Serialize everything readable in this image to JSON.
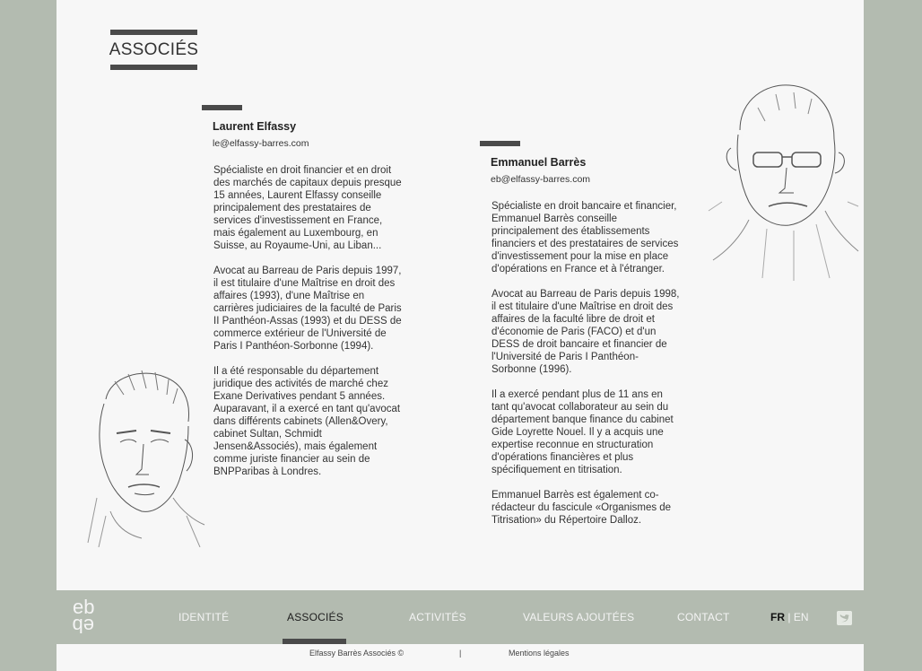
{
  "section_title": "ASSOCIÉS",
  "partners": [
    {
      "name": "Laurent Elfassy",
      "email": "le@elfassy-barres.com",
      "paragraphs": [
        "Spécialiste en droit financier et en droit des marchés de capitaux depuis presque 15 années, Laurent Elfassy conseille principalement des prestataires de services d'investissement en France, mais également au Luxembourg, en Suisse, au Royaume-Uni, au Liban...",
        "Avocat au Barreau de Paris depuis 1997, il est titulaire d'une Maîtrise en droit des affaires (1993), d'une Maîtrise en carrières judiciaires de la faculté de Paris II Panthéon-Assas (1993) et du DESS de commerce extérieur de l'Université de Paris I Panthéon-Sorbonne (1994).",
        "Il a été responsable du département juridique des activités de marché chez Exane Derivatives pendant 5 années. Auparavant, il a exercé en tant qu'avocat dans différents cabinets (Allen&Overy, cabinet Sultan, Schmidt Jensen&Associés), mais également comme juriste financier au sein de BNPParibas à Londres."
      ]
    },
    {
      "name": "Emmanuel Barrès",
      "email": "eb@elfassy-barres.com",
      "paragraphs": [
        "Spécialiste en droit bancaire et financier, Emmanuel Barrès conseille principalement des établissements financiers et des prestataires de services d'investissement pour la mise en place d'opérations en France et à l'étranger.",
        "Avocat au Barreau de Paris depuis 1998, il est titulaire d'une Maîtrise en droit des affaires de la faculté libre de droit et d'économie de Paris (FACO) et d'un DESS de droit bancaire et financier de l'Université de Paris I Panthéon-Sorbonne (1996).",
        "Il a exercé pendant plus de 11 ans en tant qu'avocat collaborateur au sein du département banque finance du cabinet Gide Loyrette Nouel. Il y a acquis une expertise reconnue en structuration d'opérations financières et plus spécifiquement en titrisation.",
        "Emmanuel Barrès est également co-rédacteur du fascicule «Organismes de Titrisation» du Répertoire Dalloz."
      ]
    }
  ],
  "nav": {
    "logo_text": "eb",
    "items": [
      "IDENTITÉ",
      "ASSOCIÉS",
      "ACTIVITÉS",
      "VALEURS AJOUTÉES",
      "CONTACT"
    ],
    "active": "ASSOCIÉS",
    "lang_fr": "FR",
    "lang_sep": "|",
    "lang_en": "EN"
  },
  "footer": {
    "copyright": "Elfassy Barrès Associés ©",
    "separator": "|",
    "legal": "Mentions légales"
  },
  "icons": [
    "twitter-icon",
    "logo-icon"
  ],
  "colors": {
    "background": "#b3bbb0",
    "panel": "#f7f7f7",
    "accent_bar": "#4a4a4a"
  }
}
